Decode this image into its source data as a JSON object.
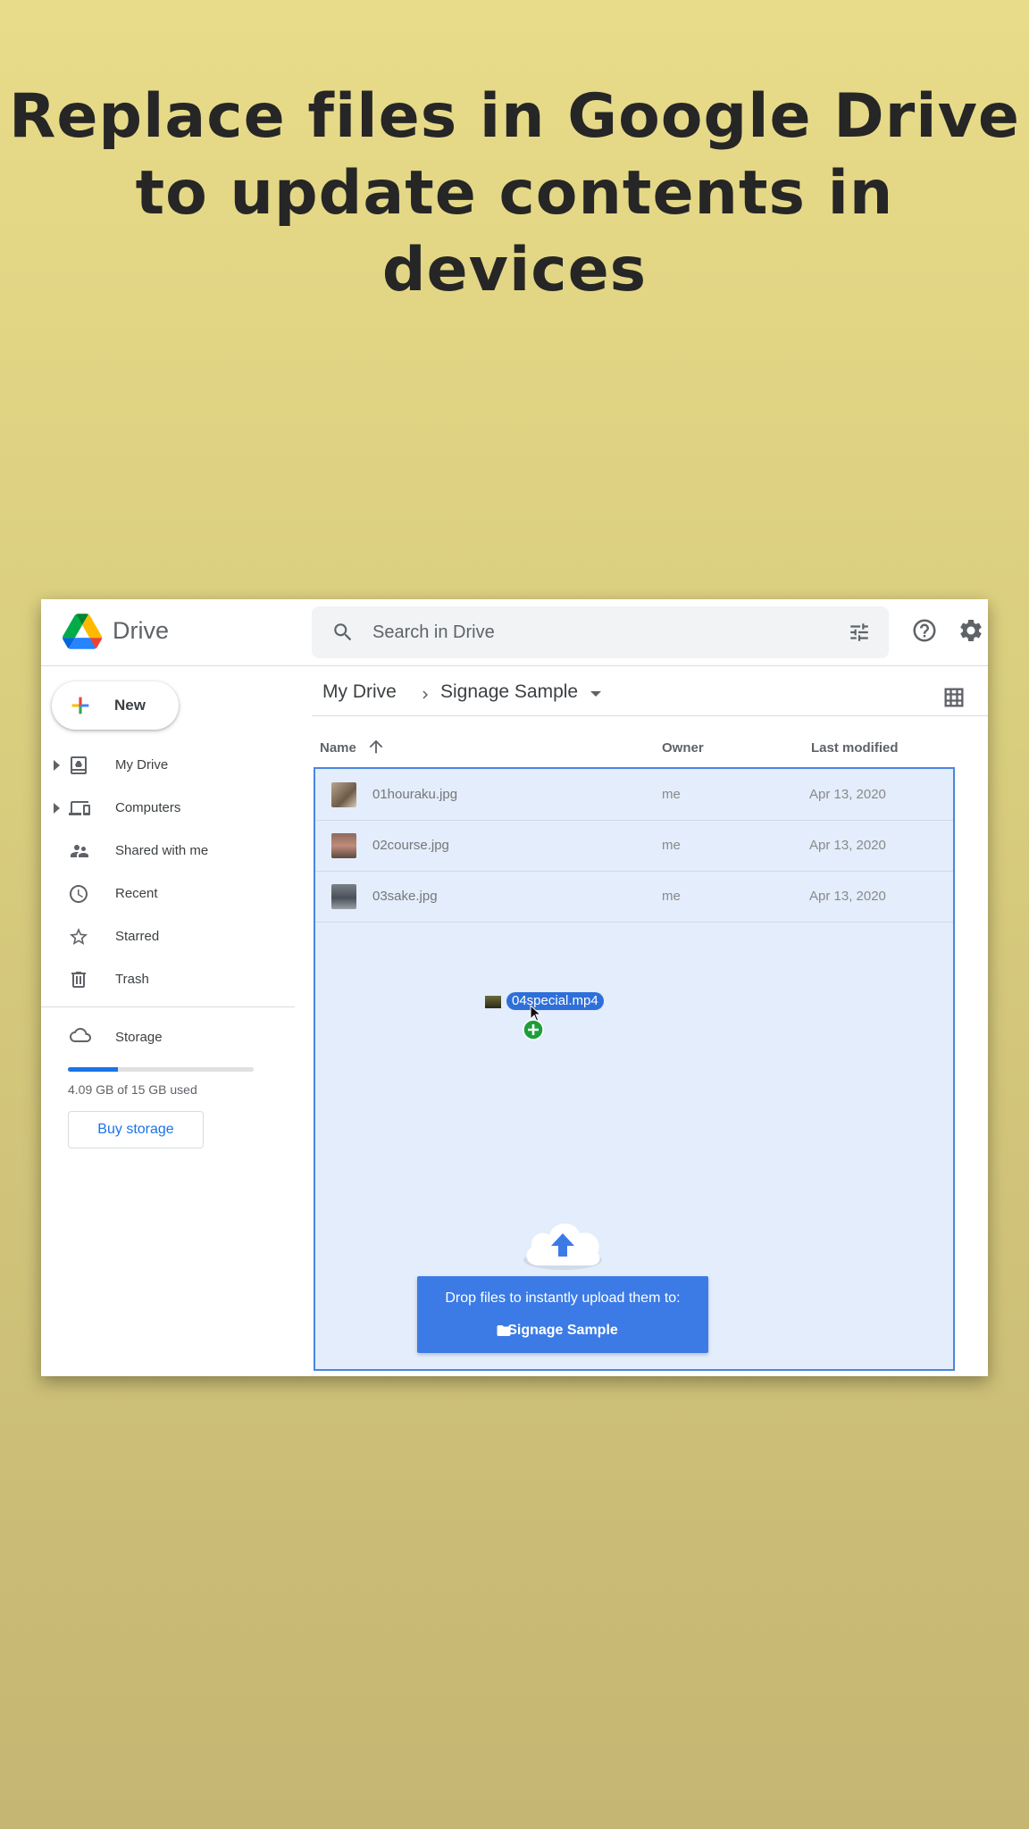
{
  "headline": {
    "line1": "Replace files in Google Drive",
    "line2": "to update contents in devices"
  },
  "app": {
    "name": "Drive"
  },
  "search": {
    "placeholder": "Search in Drive"
  },
  "sidebar": {
    "new_label": "New",
    "items": [
      {
        "label": "My Drive",
        "icon": "my-drive-icon",
        "expandable": true
      },
      {
        "label": "Computers",
        "icon": "computers-icon",
        "expandable": true
      },
      {
        "label": "Shared with me",
        "icon": "shared-icon",
        "expandable": false
      },
      {
        "label": "Recent",
        "icon": "clock-icon",
        "expandable": false
      },
      {
        "label": "Starred",
        "icon": "star-icon",
        "expandable": false
      },
      {
        "label": "Trash",
        "icon": "trash-icon",
        "expandable": false
      }
    ],
    "storage": {
      "label": "Storage",
      "used_text": "4.09 GB of 15 GB used",
      "used_fraction": 0.27,
      "buy_label": "Buy storage"
    }
  },
  "breadcrumb": {
    "root": "My Drive",
    "current": "Signage Sample"
  },
  "columns": {
    "name": "Name",
    "owner": "Owner",
    "modified": "Last modified"
  },
  "files": [
    {
      "name": "01houraku.jpg",
      "owner": "me",
      "modified": "Apr 13, 2020"
    },
    {
      "name": "02course.jpg",
      "owner": "me",
      "modified": "Apr 13, 2020"
    },
    {
      "name": "03sake.jpg",
      "owner": "me",
      "modified": "Apr 13, 2020"
    }
  ],
  "drag": {
    "file_name": "04special.mp4"
  },
  "drop_tip": {
    "line1": "Drop files to instantly upload them to:",
    "folder": "Signage Sample"
  },
  "colors": {
    "accent": "#1a73e8",
    "drop_zone_bg": "#e3edfb",
    "drop_tip_bg": "#3c7be6"
  }
}
